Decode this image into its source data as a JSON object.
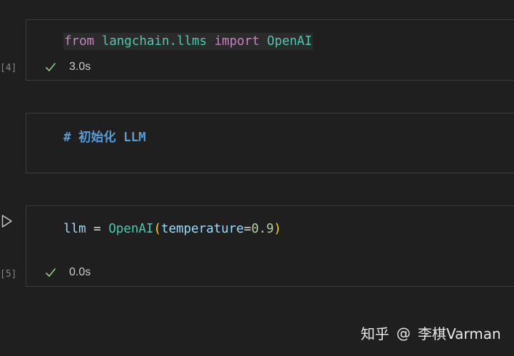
{
  "cells": [
    {
      "type": "code",
      "execution_count": "[4]",
      "code_tokens": [
        {
          "text": "from",
          "kind": "keyword"
        },
        {
          "text": " ",
          "kind": "plain"
        },
        {
          "text": "langchain.llms",
          "kind": "module"
        },
        {
          "text": " ",
          "kind": "plain"
        },
        {
          "text": "import",
          "kind": "keyword"
        },
        {
          "text": " ",
          "kind": "plain"
        },
        {
          "text": "OpenAI",
          "kind": "class"
        }
      ],
      "status": "success",
      "duration": "3.0s"
    },
    {
      "type": "markdown",
      "heading": "# 初始化 LLM"
    },
    {
      "type": "code",
      "execution_count": "[5]",
      "code_tokens": [
        {
          "text": "llm",
          "kind": "variable"
        },
        {
          "text": " = ",
          "kind": "plain"
        },
        {
          "text": "OpenAI",
          "kind": "class"
        },
        {
          "text": "(",
          "kind": "paren"
        },
        {
          "text": "temperature",
          "kind": "variable"
        },
        {
          "text": "=",
          "kind": "plain"
        },
        {
          "text": "0.9",
          "kind": "number"
        },
        {
          "text": ")",
          "kind": "paren"
        }
      ],
      "status": "success",
      "duration": "0.0s"
    }
  ],
  "icons": {
    "run": "play-icon",
    "success": "check-icon"
  },
  "watermark": {
    "logo": "知乎",
    "at": "@",
    "author": "李棋Varman"
  },
  "colors": {
    "background": "#1f1f1f",
    "cell_border": "#3c3c3c",
    "keyword": "#c586c0",
    "module": "#4ec9b0",
    "class": "#4ec9b0",
    "variable": "#9cdcfe",
    "number": "#b5cea8",
    "paren": "#ffd700",
    "markdown_heading": "#569cd6",
    "check": "#89d185"
  }
}
